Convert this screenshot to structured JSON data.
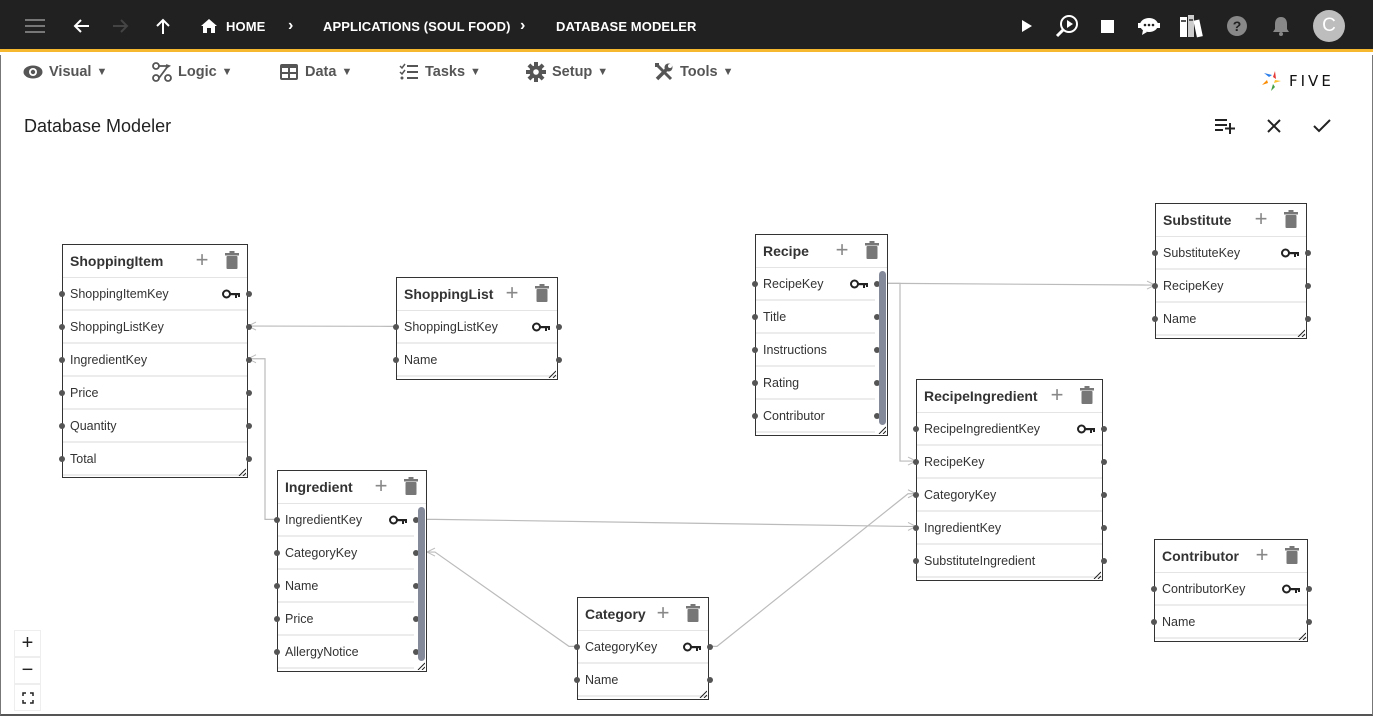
{
  "topbar": {
    "breadcrumbs": [
      "HOME",
      "APPLICATIONS (SOUL FOOD)",
      "DATABASE MODELER"
    ],
    "avatar_initial": "C",
    "accent_color": "#f5b82e",
    "icons": [
      "menu-icon",
      "back-arrow-icon",
      "forward-arrow-icon",
      "up-arrow-icon",
      "home-icon",
      "play-icon",
      "search-play-icon",
      "stop-icon",
      "chatbot-icon",
      "library-icon",
      "help-icon",
      "bell-icon"
    ]
  },
  "menu": {
    "items": [
      {
        "label": "Visual",
        "icon": "eye-icon"
      },
      {
        "label": "Logic",
        "icon": "logic-flow-icon"
      },
      {
        "label": "Data",
        "icon": "grid-icon"
      },
      {
        "label": "Tasks",
        "icon": "checklist-icon"
      },
      {
        "label": "Setup",
        "icon": "gear-icon"
      },
      {
        "label": "Tools",
        "icon": "tools-icon"
      }
    ],
    "caret": "▼",
    "brand": "FIVE"
  },
  "page": {
    "title": "Database Modeler",
    "actions": [
      "add-table",
      "cancel",
      "confirm"
    ]
  },
  "tables": [
    {
      "name": "ShoppingItem",
      "fields": [
        "ShoppingItemKey",
        "ShoppingListKey",
        "IngredientKey",
        "Price",
        "Quantity",
        "Total"
      ],
      "primary_key": "ShoppingItemKey",
      "scrollable": false
    },
    {
      "name": "ShoppingList",
      "fields": [
        "ShoppingListKey",
        "Name"
      ],
      "primary_key": "ShoppingListKey",
      "scrollable": false
    },
    {
      "name": "Ingredient",
      "fields": [
        "IngredientKey",
        "CategoryKey",
        "Name",
        "Price",
        "AllergyNotice"
      ],
      "primary_key": "IngredientKey",
      "scrollable": true
    },
    {
      "name": "Category",
      "fields": [
        "CategoryKey",
        "Name"
      ],
      "primary_key": "CategoryKey",
      "scrollable": false
    },
    {
      "name": "Recipe",
      "fields": [
        "RecipeKey",
        "Title",
        "Instructions",
        "Rating",
        "Contributor"
      ],
      "primary_key": "RecipeKey",
      "scrollable": true
    },
    {
      "name": "RecipeIngredient",
      "fields": [
        "RecipeIngredientKey",
        "RecipeKey",
        "CategoryKey",
        "IngredientKey",
        "SubstituteIngredient"
      ],
      "primary_key": "RecipeIngredientKey",
      "scrollable": false
    },
    {
      "name": "Substitute",
      "fields": [
        "SubstituteKey",
        "RecipeKey",
        "Name"
      ],
      "primary_key": "SubstituteKey",
      "scrollable": false
    },
    {
      "name": "Contributor",
      "fields": [
        "ContributorKey",
        "Name"
      ],
      "primary_key": "ContributorKey",
      "scrollable": false
    }
  ],
  "relationships": [
    {
      "from": "ShoppingList.ShoppingListKey",
      "to": "ShoppingItem.ShoppingListKey"
    },
    {
      "from": "Ingredient.IngredientKey",
      "to": "ShoppingItem.IngredientKey"
    },
    {
      "from": "Category.CategoryKey",
      "to": "Ingredient.CategoryKey"
    },
    {
      "from": "Recipe.RecipeKey",
      "to": "Substitute.RecipeKey"
    },
    {
      "from": "Recipe.RecipeKey",
      "to": "RecipeIngredient.RecipeKey"
    },
    {
      "from": "Category.CategoryKey",
      "to": "RecipeIngredient.CategoryKey"
    },
    {
      "from": "Ingredient.IngredientKey",
      "to": "RecipeIngredient.IngredientKey"
    }
  ],
  "zoom_controls": [
    "+",
    "−",
    "fit"
  ]
}
